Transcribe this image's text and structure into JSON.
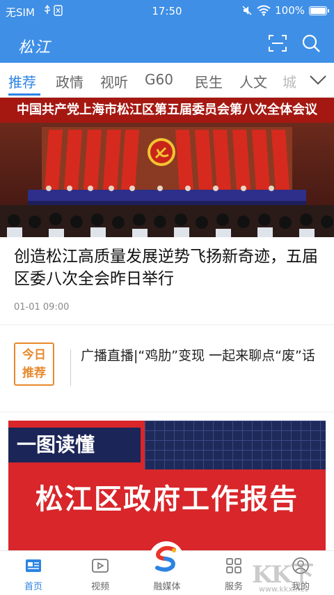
{
  "status_bar": {
    "carrier": "无SIM",
    "time": "17:50",
    "battery": "100%",
    "battery_level": 1.0
  },
  "header": {
    "logo_text": "松江",
    "icons": [
      "scan-icon",
      "search-icon"
    ]
  },
  "tabs": [
    {
      "label": "推荐",
      "active": true
    },
    {
      "label": "政情"
    },
    {
      "label": "视听"
    },
    {
      "label": "G60"
    },
    {
      "label": "民生"
    },
    {
      "label": "人文"
    },
    {
      "label": "城"
    }
  ],
  "hero": {
    "banner_text": "中国共产党上海市松江区第五届委员会第八次全体会议"
  },
  "article": {
    "title": "创造松江高质量发展逆势飞扬新奇迹，五届区委八次全会昨日举行",
    "time": "01-01 09:00"
  },
  "recommend": {
    "badge_line1": "今日",
    "badge_line2": "推荐",
    "text": "广播直播|“鸡肋”变现  一起来聊点“废”话"
  },
  "poster": {
    "tag": "一图读懂",
    "title": "松江区政府工作报告"
  },
  "bottom_nav": [
    {
      "label": "首页",
      "icon": "home-icon",
      "active": true
    },
    {
      "label": "视频",
      "icon": "video-icon"
    },
    {
      "label": "融媒体",
      "icon": "media-logo-icon"
    },
    {
      "label": "服务",
      "icon": "grid-icon"
    },
    {
      "label": "我的",
      "icon": "user-icon"
    }
  ],
  "watermark": {
    "text": "KK下载",
    "url": "www.kkx.net"
  },
  "colors": {
    "primary": "#3f8fe6",
    "tab_active": "#2c83e2",
    "badge": "#e8892b",
    "poster_red": "#d8262a",
    "poster_navy": "#1b2557"
  }
}
